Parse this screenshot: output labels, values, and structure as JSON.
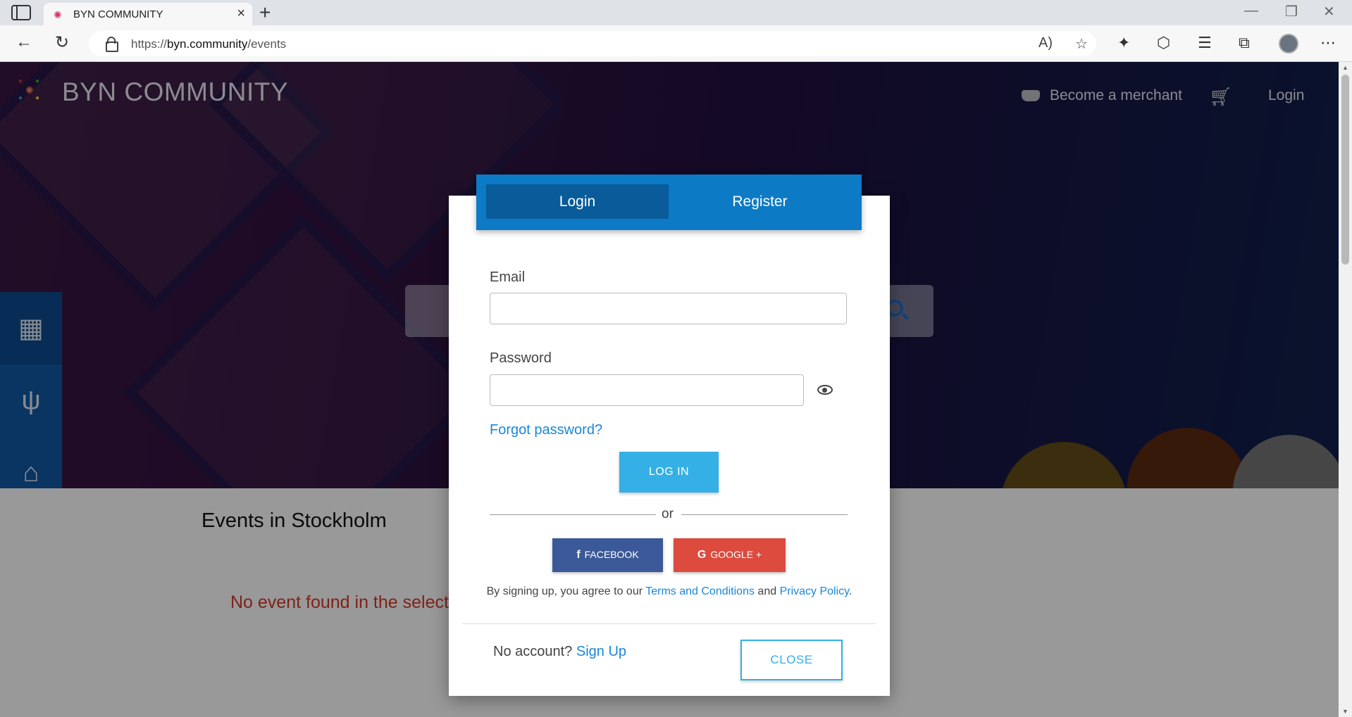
{
  "browser": {
    "tab_title": "BYN COMMUNITY",
    "url_prefix": "https://",
    "url_host": "byn.community",
    "url_path": "/events"
  },
  "site": {
    "title": "BYN COMMUNITY",
    "nav": {
      "merchant": "Become a merchant",
      "login": "Login"
    },
    "sidebar_icons": [
      "calendar-icon",
      "utensils-icon",
      "store-icon",
      "briefcase-icon",
      "comments-icon"
    ]
  },
  "content": {
    "title": "Events in Stockholm",
    "message": "No event found in the select"
  },
  "modal": {
    "tabs": {
      "login": "Login",
      "register": "Register"
    },
    "email_label": "Email",
    "email_value": "",
    "password_label": "Password",
    "password_value": "",
    "forgot": "Forgot password?",
    "login_button": "LOG IN",
    "or": "or",
    "facebook": "FACEBOOK",
    "google": "GOOGLE +",
    "terms_prefix": "By signing up, you agree to our ",
    "terms_link": "Terms and Conditions",
    "terms_and": " and ",
    "privacy_link": "Privacy Policy",
    "terms_suffix": ".",
    "no_account": "No account?",
    "signup": "Sign Up",
    "close": "CLOSE"
  },
  "colors": {
    "accent_blue": "#0d7ac5",
    "button_light_blue": "#34b0e6",
    "facebook": "#3b5998",
    "google": "#dc4b3e",
    "error_red": "#d33a2c",
    "sidebar": "#1159a6"
  }
}
